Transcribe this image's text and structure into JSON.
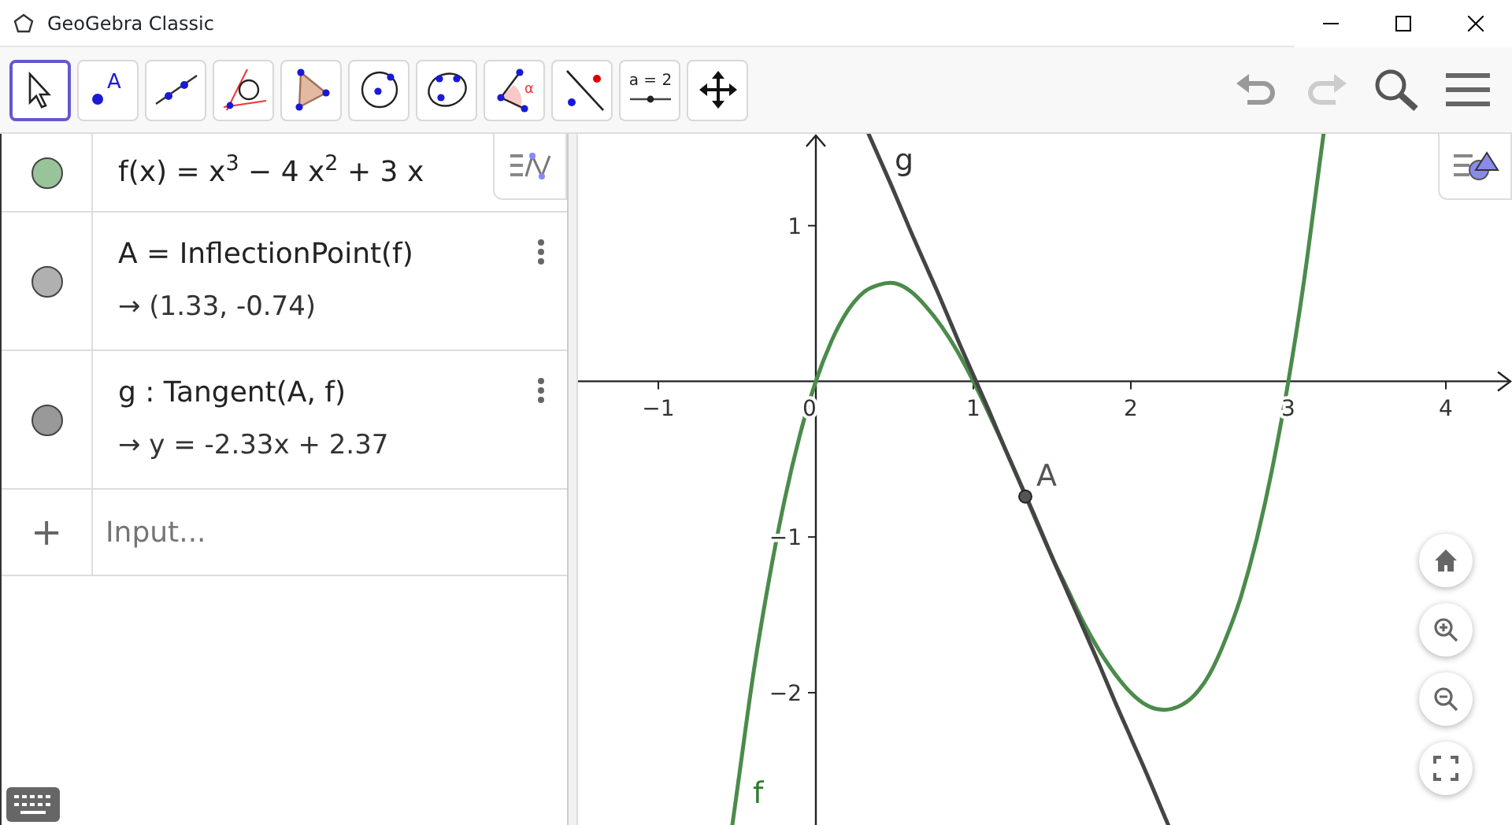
{
  "window": {
    "title": "GeoGebra Classic"
  },
  "tools": [
    {
      "kind": "move",
      "selected": true
    },
    {
      "kind": "point",
      "label": "A",
      "selected": false
    },
    {
      "kind": "line",
      "selected": false
    },
    {
      "kind": "tangents",
      "selected": false
    },
    {
      "kind": "polygon",
      "selected": false
    },
    {
      "kind": "circle",
      "selected": false
    },
    {
      "kind": "conic",
      "selected": false
    },
    {
      "kind": "angle",
      "label": "α",
      "selected": false
    },
    {
      "kind": "reflect",
      "selected": false
    },
    {
      "kind": "slider",
      "label": "a = 2",
      "selected": false
    },
    {
      "kind": "pan",
      "selected": false
    }
  ],
  "algebra": {
    "items": [
      {
        "definition": "f(x) = x$^{3}$ − 4 x$^{2}$ + 3 x",
        "color": "#99c499"
      },
      {
        "definition": "A = InflectionPoint(f)",
        "value": "→ (1.33, -0.74)",
        "color": "#b0b0b0"
      },
      {
        "definition": "g : Tangent(A, f)",
        "value": "→ y = -2.33x + 2.37",
        "color": "#999999"
      }
    ],
    "input": {
      "add": "+",
      "placeholder": "Input..."
    }
  },
  "graphics": {
    "chart_data": {
      "type": "line",
      "xlim": [
        -1.51,
        4.42
      ],
      "ylim": [
        -2.85,
        1.59
      ],
      "xticks": [
        {
          "value": -1,
          "label": "−1"
        },
        0,
        1,
        2,
        3,
        4
      ],
      "yticks": [
        1,
        {
          "value": -1,
          "label": "−1"
        },
        {
          "value": -2,
          "label": "−2"
        }
      ],
      "x": [
        -0.5,
        -0.4,
        -0.3,
        -0.2,
        -0.1,
        0,
        0.1,
        0.2,
        0.3,
        0.4,
        0.5,
        0.6,
        0.7,
        0.8,
        0.9,
        1,
        1.1,
        1.2,
        1.3,
        1.4,
        1.5,
        1.6,
        1.7,
        1.8,
        1.9,
        2,
        2.1,
        2.2,
        2.3,
        2.4,
        2.5,
        2.6,
        2.7,
        2.8,
        2.9,
        3,
        3.1,
        3.2
      ],
      "series": [
        {
          "name": "f",
          "color": "#4b8b4b",
          "values": [
            -2.63,
            -1.9,
            -1.29,
            -0.77,
            -0.34,
            0,
            0.26,
            0.45,
            0.57,
            0.62,
            0.63,
            0.58,
            0.48,
            0.35,
            0.19,
            0,
            -0.21,
            -0.43,
            -0.66,
            -0.9,
            -1.13,
            -1.34,
            -1.55,
            -1.73,
            -1.88,
            -2,
            -2.08,
            -2.11,
            -2.09,
            -2.02,
            -1.88,
            -1.66,
            -1.38,
            -1.01,
            -0.55,
            0,
            0.65,
            1.41
          ]
        },
        {
          "name": "g",
          "color": "#444444",
          "values": [
            null,
            null,
            null,
            null,
            null,
            null,
            null,
            null,
            null,
            1.44,
            1.21,
            0.97,
            0.74,
            0.51,
            0.27,
            0.04,
            -0.19,
            -0.43,
            -0.66,
            -0.89,
            -1.13,
            -1.36,
            -1.59,
            -1.82,
            -2.06,
            -2.29,
            -2.52,
            -2.76,
            null,
            null,
            null,
            null,
            null,
            null,
            null,
            null,
            null,
            null
          ]
        }
      ],
      "annotations": [
        {
          "text": "A",
          "x": 1.33,
          "y": -0.74
        }
      ]
    }
  }
}
